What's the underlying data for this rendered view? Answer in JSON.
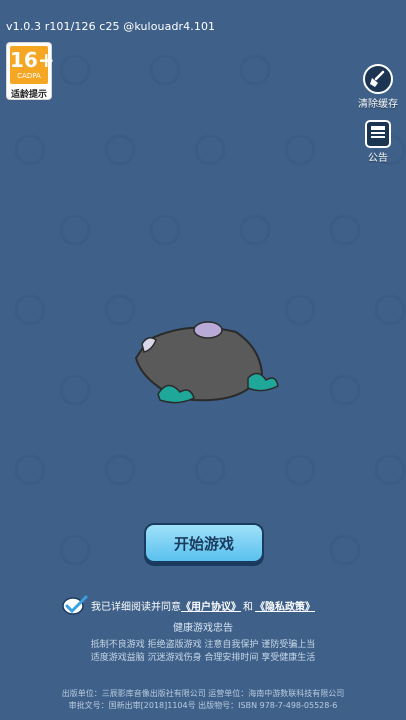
{
  "version_text": "v1.0.3 r101/126 c25 @kulouadr4.101",
  "age_badge": {
    "age": "16+",
    "org": "CADPA",
    "label": "适龄提示"
  },
  "side_buttons": {
    "clear_cache": "清除缓存",
    "notice": "公告"
  },
  "start_button": "开始游戏",
  "agreement": {
    "prefix": "我已详细阅读并同意",
    "user_agreement": "《用户协议》",
    "and": "和",
    "privacy_policy": "《隐私政策》"
  },
  "health_advice": {
    "title": "健康游戏忠告",
    "line1": "抵制不良游戏  拒绝盗版游戏  注意自我保护  谨防受骗上当",
    "line2": "适度游戏益脑  沉迷游戏伤身  合理安排时间  享受健康生活"
  },
  "publisher": {
    "line1": "出版单位：三辰影库音像出版社有限公司   运营单位：海南中游数联科技有限公司",
    "line2": "审批文号：国新出审[2018]1104号   出版物号：ISBN 978-7-498-05528-6"
  },
  "colors": {
    "background": "#3f6189",
    "button": "#5ac1ef",
    "badge": "#f5a623"
  }
}
